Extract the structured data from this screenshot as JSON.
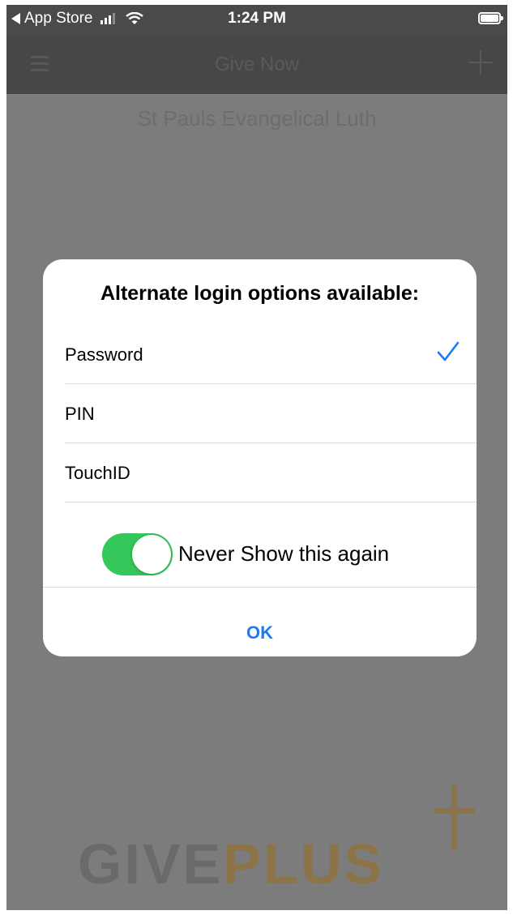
{
  "status_bar": {
    "back_label": "App Store",
    "time": "1:24 PM"
  },
  "nav": {
    "title": "Give Now",
    "menu_icon": "hamburger-menu-icon",
    "add_icon": "plus-icon"
  },
  "church_name": "St Pauls Evangelical Luth",
  "brand": {
    "part1": "GIVE",
    "part2": "PLUS"
  },
  "dialog": {
    "title": "Alternate login options available:",
    "options": [
      {
        "label": "Password",
        "selected": true
      },
      {
        "label": "PIN",
        "selected": false
      },
      {
        "label": "TouchID",
        "selected": false
      }
    ],
    "toggle": {
      "label": "Never Show this again",
      "on": true
    },
    "ok_label": "OK"
  },
  "colors": {
    "accent": "#1a7cf2",
    "toggle_on": "#34c759",
    "overlay": "#7c7c7c"
  }
}
